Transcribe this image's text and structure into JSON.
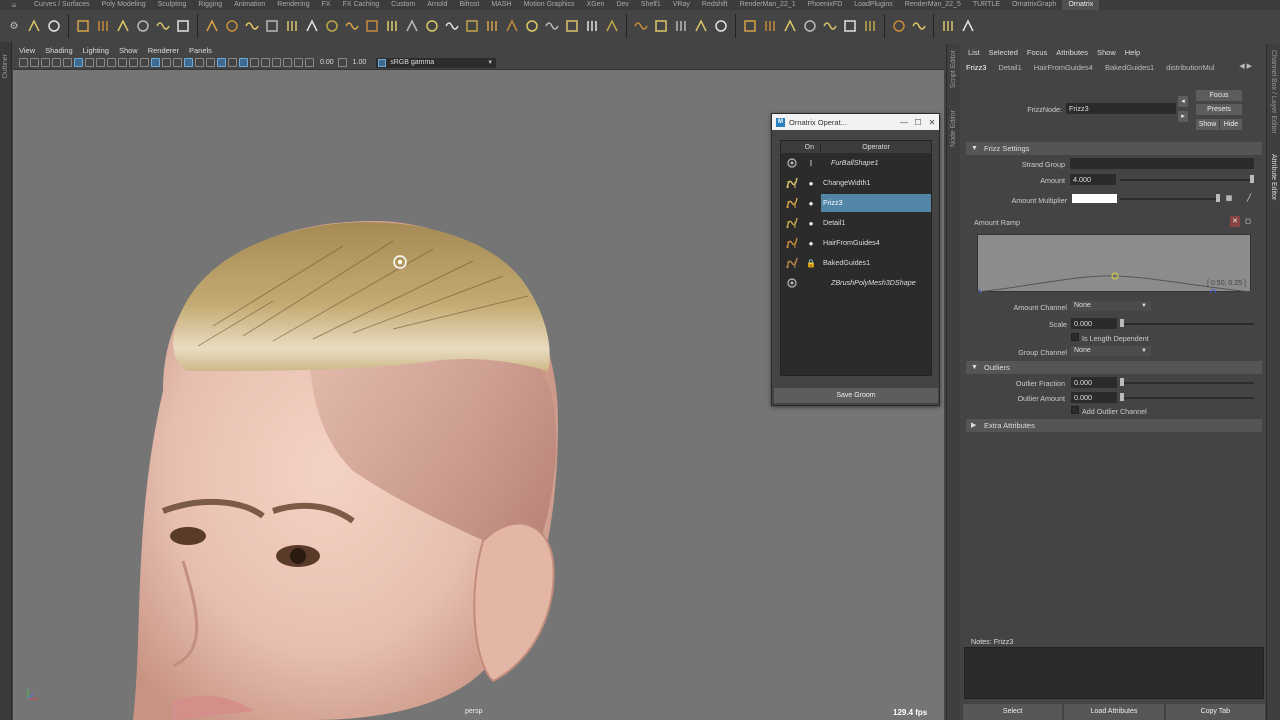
{
  "shelf_tabs": [
    "Curves / Surfaces",
    "Poly Modeling",
    "Sculpting",
    "Rigging",
    "Animation",
    "Rendering",
    "FX",
    "FX Caching",
    "Custom",
    "Arnold",
    "Bifrost",
    "MASH",
    "Motion Graphics",
    "XGen",
    "Dev",
    "Shelf1",
    "VRay",
    "Redshift",
    "RenderMan_22_1",
    "PhoenixFD",
    "LoadPlugins",
    "RenderMan_22_5",
    "TURTLE",
    "OrnatrixGraph",
    "Ornatrix"
  ],
  "active_shelf_tab": "Ornatrix",
  "left_strip_label": "Outliner",
  "viewport": {
    "menu": [
      "View",
      "Shading",
      "Lighting",
      "Show",
      "Renderer",
      "Panels"
    ],
    "exposure": "0.00",
    "gamma_value": "1.00",
    "color_space": "sRGB gamma",
    "camera": "persp",
    "fps": "129.4 fps"
  },
  "ornatrix_window": {
    "title": "Ornatrix Operat...",
    "col_on": "On",
    "col_operator": "Operator",
    "operators": [
      {
        "name": "FurBallShape1",
        "on": "I",
        "style": "italic",
        "icon": "furball-icon"
      },
      {
        "name": "ChangeWidth1",
        "on": "●",
        "style": "normal",
        "icon": "change-width-icon"
      },
      {
        "name": "Frizz3",
        "on": "●",
        "style": "selected",
        "icon": "frizz-icon"
      },
      {
        "name": "Detail1",
        "on": "●",
        "style": "normal",
        "icon": "detail-icon"
      },
      {
        "name": "HairFromGuides4",
        "on": "●",
        "style": "normal",
        "icon": "hair-from-guides-icon"
      },
      {
        "name": "BakedGuides1",
        "on": "🔒",
        "style": "normal",
        "icon": "baked-guides-icon"
      },
      {
        "name": "ZBrushPolyMesh3DShape",
        "on": "",
        "style": "italic",
        "icon": "mesh-icon"
      }
    ],
    "save_label": "Save Groom"
  },
  "right_strips": {
    "left_labels": [
      "Script Editor",
      "Node Editor"
    ],
    "right_labels": [
      "Channel Box / Layer Editor",
      "Attribute Editor"
    ]
  },
  "attribute_editor": {
    "menu": [
      "List",
      "Selected",
      "Focus",
      "Attributes",
      "Show",
      "Help"
    ],
    "tabs": [
      "Frizz3",
      "Detail1",
      "HairFromGuides4",
      "BakedGuides1",
      "distributionMul"
    ],
    "node_label": "FrizzNode:",
    "node_value": "Frizz3",
    "buttons": {
      "focus": "Focus",
      "presets": "Presets",
      "show": "Show",
      "hide": "Hide"
    },
    "frizz_settings": {
      "title": "Frizz Settings",
      "strand_group_label": "Strand Group",
      "strand_group_value": "",
      "amount_label": "Amount",
      "amount_value": "4.000",
      "amount_multiplier_label": "Amount Multiplier",
      "amount_ramp_label": "Amount Ramp",
      "ramp_readout": "[ 0.50, 0.25 ]",
      "amount_channel_label": "Amount Channel",
      "amount_channel_value": "None",
      "scale_label": "Scale",
      "scale_value": "0.000",
      "is_length_dependent_label": "Is Length Dependent",
      "group_channel_label": "Group Channel",
      "group_channel_value": "None"
    },
    "outliers": {
      "title": "Outliers",
      "fraction_label": "Outlier Fraction",
      "fraction_value": "0.000",
      "amount_label": "Outlier Amount",
      "amount_value": "0.000",
      "add_channel_label": "Add Outlier Channel"
    },
    "extra_attributes": "Extra Attributes",
    "notes_label": "Notes:  Frizz3",
    "bottom_buttons": [
      "Select",
      "Load Attributes",
      "Copy Tab"
    ]
  },
  "colors": {
    "selection": "#5285a6",
    "hair": "#b8a06a",
    "skin": "#e7bfb0",
    "viewport_bg": "#757575"
  }
}
